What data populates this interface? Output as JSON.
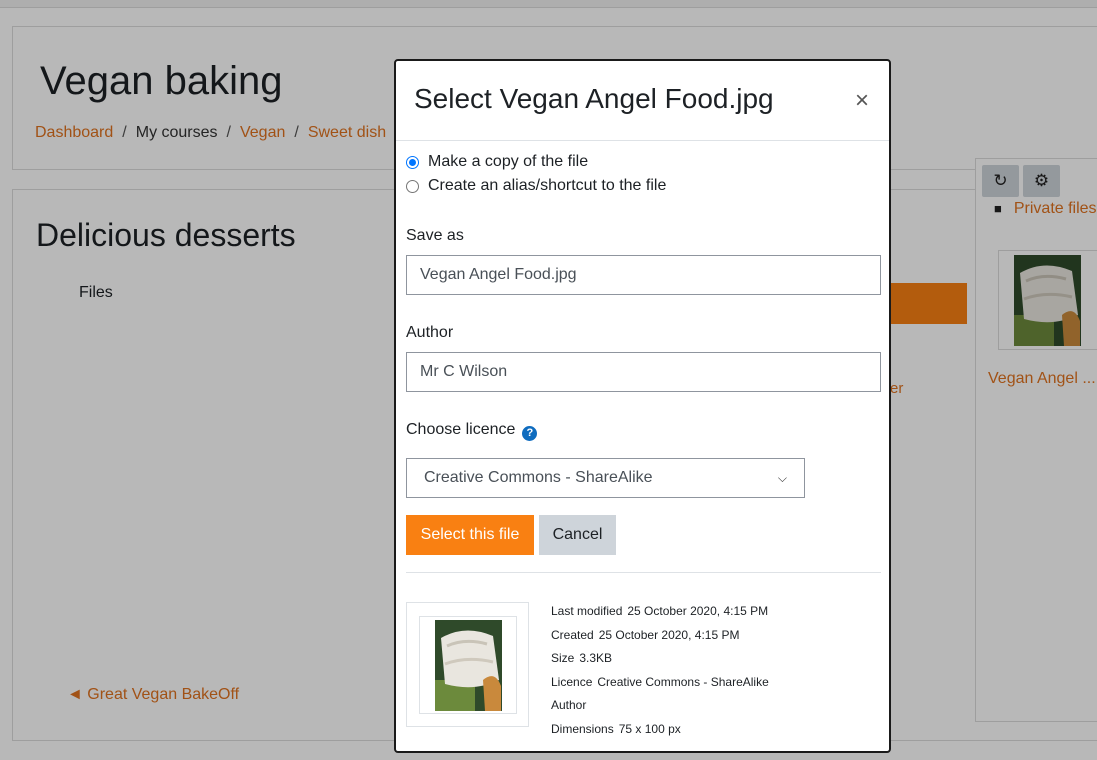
{
  "page": {
    "course_title": "Vegan baking",
    "breadcrumb": [
      "Dashboard",
      "My courses",
      "Vegan",
      "Sweet dish"
    ],
    "section_title": "Delicious desserts",
    "files_label": "Files",
    "prev_link": "◄ Great Vegan BakeOff",
    "stray_text": "er"
  },
  "filepicker": {
    "toolbar_icons": [
      "refresh-icon",
      "gear-icon"
    ],
    "path_label": "Private files",
    "thumb_label": "Vegan Angel ..."
  },
  "dialog": {
    "title": "Select Vegan Angel Food.jpg",
    "close_glyph": "×",
    "radio_copy": "Make a copy of the file",
    "radio_alias": "Create an alias/shortcut to the file",
    "radio_selected": "copy",
    "save_as_label": "Save as",
    "save_as_value": "Vegan Angel Food.jpg",
    "author_label": "Author",
    "author_value": "Mr C Wilson",
    "licence_label": "Choose licence",
    "licence_value": "Creative Commons - ShareAlike",
    "select_button": "Select this file",
    "cancel_button": "Cancel",
    "meta": {
      "last_modified_label": "Last modified",
      "last_modified_value": "25 October 2020, 4:15 PM",
      "created_label": "Created",
      "created_value": "25 October 2020, 4:15 PM",
      "size_label": "Size",
      "size_value": "3.3KB",
      "licence_label": "Licence",
      "licence_value": "Creative Commons - ShareAlike",
      "author_label": "Author",
      "author_value": "",
      "dimensions_label": "Dimensions",
      "dimensions_value": "75 x 100 px"
    }
  },
  "colors": {
    "accent": "#f98012",
    "link": "#e0721f",
    "radio": "#0075ff",
    "help": "#0f6cbf"
  }
}
